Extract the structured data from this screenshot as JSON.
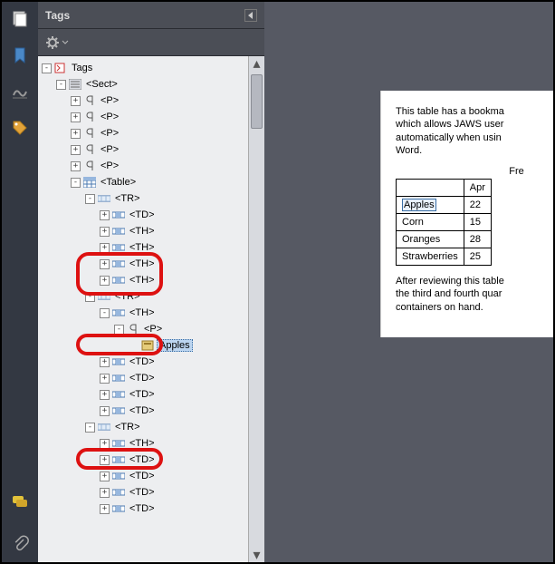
{
  "panel": {
    "title": "Tags",
    "root": "Tags",
    "tags": {
      "sect": "<Sect>",
      "p": "<P>",
      "table": "<Table>",
      "tr": "<TR>",
      "td": "<TD>",
      "th": "<TH>"
    },
    "selected_text": "Apples"
  },
  "doc": {
    "para1_l1": "This table has a bookma",
    "para1_l2": "which allows JAWS user",
    "para1_l3": "automatically when usin",
    "para1_l4": "Word.",
    "table_caption": "Fre",
    "table": {
      "h1": "",
      "h2": "Apr",
      "r1c1": "Apples",
      "r1c2": "22",
      "r2c1": "Corn",
      "r2c2": "15",
      "r3c1": "Oranges",
      "r3c2": "28",
      "r4c1": "Strawberries",
      "r4c2": "25"
    },
    "para2_l1": "After reviewing this table",
    "para2_l2": "the third and fourth quar",
    "para2_l3": "containers on hand."
  }
}
